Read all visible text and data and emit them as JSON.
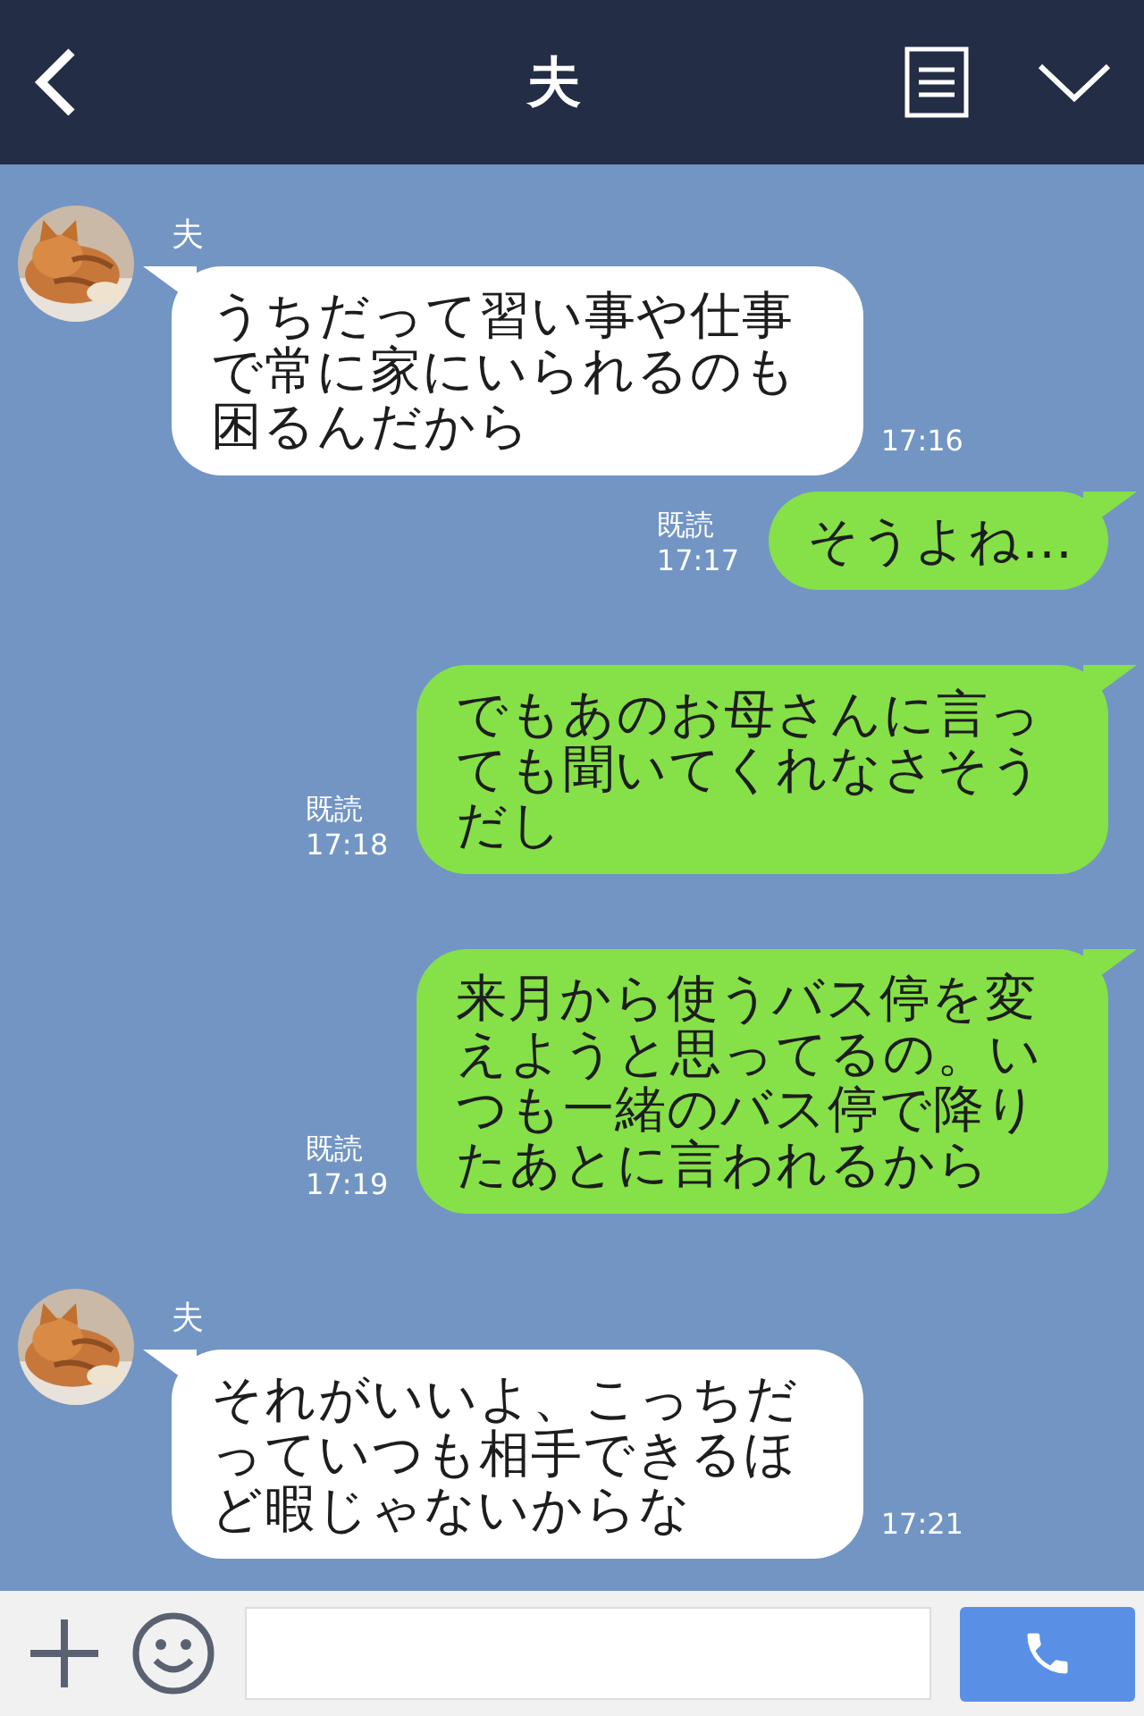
{
  "header": {
    "title": "夫"
  },
  "messages": [
    {
      "kind": "incoming",
      "name": "夫",
      "text": "うちだって習い事や仕事で常に家にいられるのも困るんだから",
      "time": "17:16"
    },
    {
      "kind": "outgoing",
      "read": "既読",
      "text": "そうよね…",
      "time": "17:17"
    },
    {
      "kind": "outgoing",
      "read": "既読",
      "text": "でもあのお母さんに言っても聞いてくれなさそうだし",
      "time": "17:18"
    },
    {
      "kind": "outgoing",
      "read": "既読",
      "text": "来月から使うバス停を変えようと思ってるの。いつも一緒のバス停で降りたあとに言われるから",
      "time": "17:19"
    },
    {
      "kind": "incoming",
      "name": "夫",
      "text": "それがいいよ、こっちだっていつも相手できるほど暇じゃないからな",
      "time": "17:21"
    }
  ]
}
